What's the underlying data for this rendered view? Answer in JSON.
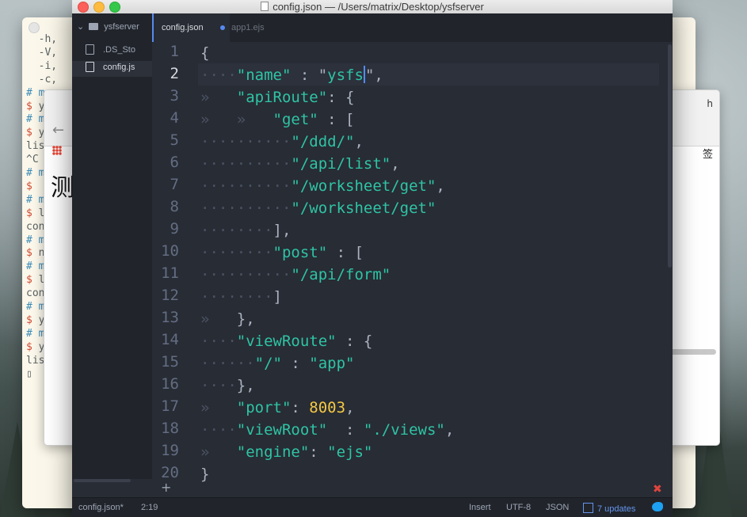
{
  "window": {
    "title": "config.json — /Users/matrix/Desktop/ysfserver"
  },
  "terminal": {
    "lines": [
      {
        "hash": "",
        "dollar": "",
        "text": "  -h,"
      },
      {
        "hash": "",
        "dollar": "",
        "text": "  -V,"
      },
      {
        "hash": "",
        "dollar": "",
        "text": "  -i,"
      },
      {
        "hash": "",
        "dollar": "",
        "text": "  -c,"
      },
      {
        "hash": "# m",
        "dollar": "",
        "text": ""
      },
      {
        "hash": "",
        "dollar": "$ ",
        "text": "y"
      },
      {
        "hash": "# m",
        "dollar": "",
        "text": ""
      },
      {
        "hash": "",
        "dollar": "$ ",
        "text": "y"
      },
      {
        "hash": "",
        "dollar": "",
        "text": "lis"
      },
      {
        "hash": "",
        "dollar": "",
        "text": "^C"
      },
      {
        "hash": "# m",
        "dollar": "",
        "text": ""
      },
      {
        "hash": "",
        "dollar": "$",
        "text": ""
      },
      {
        "hash": "# m",
        "dollar": "",
        "text": ""
      },
      {
        "hash": "",
        "dollar": "$ ",
        "text": "l"
      },
      {
        "hash": "",
        "dollar": "",
        "text": "con"
      },
      {
        "hash": "# m",
        "dollar": "",
        "text": ""
      },
      {
        "hash": "",
        "dollar": "$ ",
        "text": "n"
      },
      {
        "hash": "# m",
        "dollar": "",
        "text": ""
      },
      {
        "hash": "",
        "dollar": "$ ",
        "text": "l"
      },
      {
        "hash": "",
        "dollar": "",
        "text": "con"
      },
      {
        "hash": "# m",
        "dollar": "",
        "text": ""
      },
      {
        "hash": "",
        "dollar": "$ ",
        "text": "y"
      },
      {
        "hash": "# matri",
        "dollar": "",
        "text": ""
      },
      {
        "hash": "",
        "dollar": "$ ",
        "text": "ysfse"
      },
      {
        "hash": "",
        "dollar": "",
        "text": "listeni"
      },
      {
        "hash": "",
        "dollar": "",
        "text": "▯"
      }
    ]
  },
  "browser": {
    "big_char": "测",
    "right_char": "签",
    "right_button": "h"
  },
  "sidebar": {
    "root": "ysfserver",
    "items": [
      {
        "label": ".DS_Sto"
      },
      {
        "label": "config.js"
      }
    ]
  },
  "tabs": [
    {
      "label": "config.json",
      "modified": true
    },
    {
      "label": "app1.ejs",
      "modified": false
    }
  ],
  "editor": {
    "current_line": 2,
    "lines": [
      {
        "n": "1",
        "segs": [
          [
            "p",
            "{"
          ]
        ]
      },
      {
        "n": "2",
        "segs": [
          [
            "w",
            "····"
          ],
          [
            "k",
            "\"name\""
          ],
          [
            "p",
            " : \""
          ],
          [
            "s",
            "ysfs"
          ],
          [
            "c",
            ""
          ],
          [
            "p",
            "\","
          ]
        ]
      },
      {
        "n": "3",
        "segs": [
          [
            "w",
            "»   "
          ],
          [
            "k",
            "\"apiRoute\""
          ],
          [
            "p",
            ": {"
          ]
        ]
      },
      {
        "n": "4",
        "segs": [
          [
            "w",
            "»   »   "
          ],
          [
            "k",
            "\"get\""
          ],
          [
            "p",
            " : ["
          ]
        ]
      },
      {
        "n": "5",
        "segs": [
          [
            "w",
            "··········"
          ],
          [
            "s",
            "\"/ddd/\""
          ],
          [
            "p",
            ","
          ]
        ]
      },
      {
        "n": "6",
        "segs": [
          [
            "w",
            "··········"
          ],
          [
            "s",
            "\"/api/list\""
          ],
          [
            "p",
            ","
          ]
        ]
      },
      {
        "n": "7",
        "segs": [
          [
            "w",
            "··········"
          ],
          [
            "s",
            "\"/worksheet/get\""
          ],
          [
            "p",
            ","
          ]
        ]
      },
      {
        "n": "8",
        "segs": [
          [
            "w",
            "··········"
          ],
          [
            "s",
            "\"/worksheet/get\""
          ]
        ]
      },
      {
        "n": "9",
        "segs": [
          [
            "w",
            "········"
          ],
          [
            "p",
            "],"
          ]
        ]
      },
      {
        "n": "10",
        "segs": [
          [
            "w",
            "········"
          ],
          [
            "k",
            "\"post\""
          ],
          [
            "p",
            " : ["
          ]
        ]
      },
      {
        "n": "11",
        "segs": [
          [
            "w",
            "··········"
          ],
          [
            "s",
            "\"/api/form\""
          ]
        ]
      },
      {
        "n": "12",
        "segs": [
          [
            "w",
            "········"
          ],
          [
            "p",
            "]"
          ]
        ]
      },
      {
        "n": "13",
        "segs": [
          [
            "w",
            "»   "
          ],
          [
            "p",
            "},"
          ]
        ]
      },
      {
        "n": "14",
        "segs": [
          [
            "w",
            "····"
          ],
          [
            "k",
            "\"viewRoute\""
          ],
          [
            "p",
            " : {"
          ]
        ]
      },
      {
        "n": "15",
        "segs": [
          [
            "w",
            "······"
          ],
          [
            "k",
            "\"/\""
          ],
          [
            "p",
            " : "
          ],
          [
            "s",
            "\"app\""
          ]
        ]
      },
      {
        "n": "16",
        "segs": [
          [
            "w",
            "····"
          ],
          [
            "p",
            "},"
          ]
        ]
      },
      {
        "n": "17",
        "segs": [
          [
            "w",
            "»   "
          ],
          [
            "k",
            "\"port\""
          ],
          [
            "p",
            ": "
          ],
          [
            "n",
            "8003"
          ],
          [
            "p",
            ","
          ]
        ]
      },
      {
        "n": "18",
        "segs": [
          [
            "w",
            "····"
          ],
          [
            "k",
            "\"viewRoot\""
          ],
          [
            "p",
            "  : "
          ],
          [
            "s",
            "\"./views\""
          ],
          [
            "p",
            ","
          ]
        ]
      },
      {
        "n": "19",
        "segs": [
          [
            "w",
            "»   "
          ],
          [
            "k",
            "\"engine\""
          ],
          [
            "p",
            ": "
          ],
          [
            "s",
            "\"ejs\""
          ]
        ]
      },
      {
        "n": "20",
        "segs": [
          [
            "p",
            "}"
          ]
        ]
      }
    ]
  },
  "statusbar": {
    "file": "config.json*",
    "position": "2:19",
    "mode": "Insert",
    "encoding": "UTF-8",
    "grammar": "JSON",
    "updates": "7 updates"
  },
  "colors": {
    "accent": "#568af2",
    "key": "#2ec4a6",
    "string": "#2ec4a6",
    "number": "#f5c945",
    "background": "#282c34"
  }
}
